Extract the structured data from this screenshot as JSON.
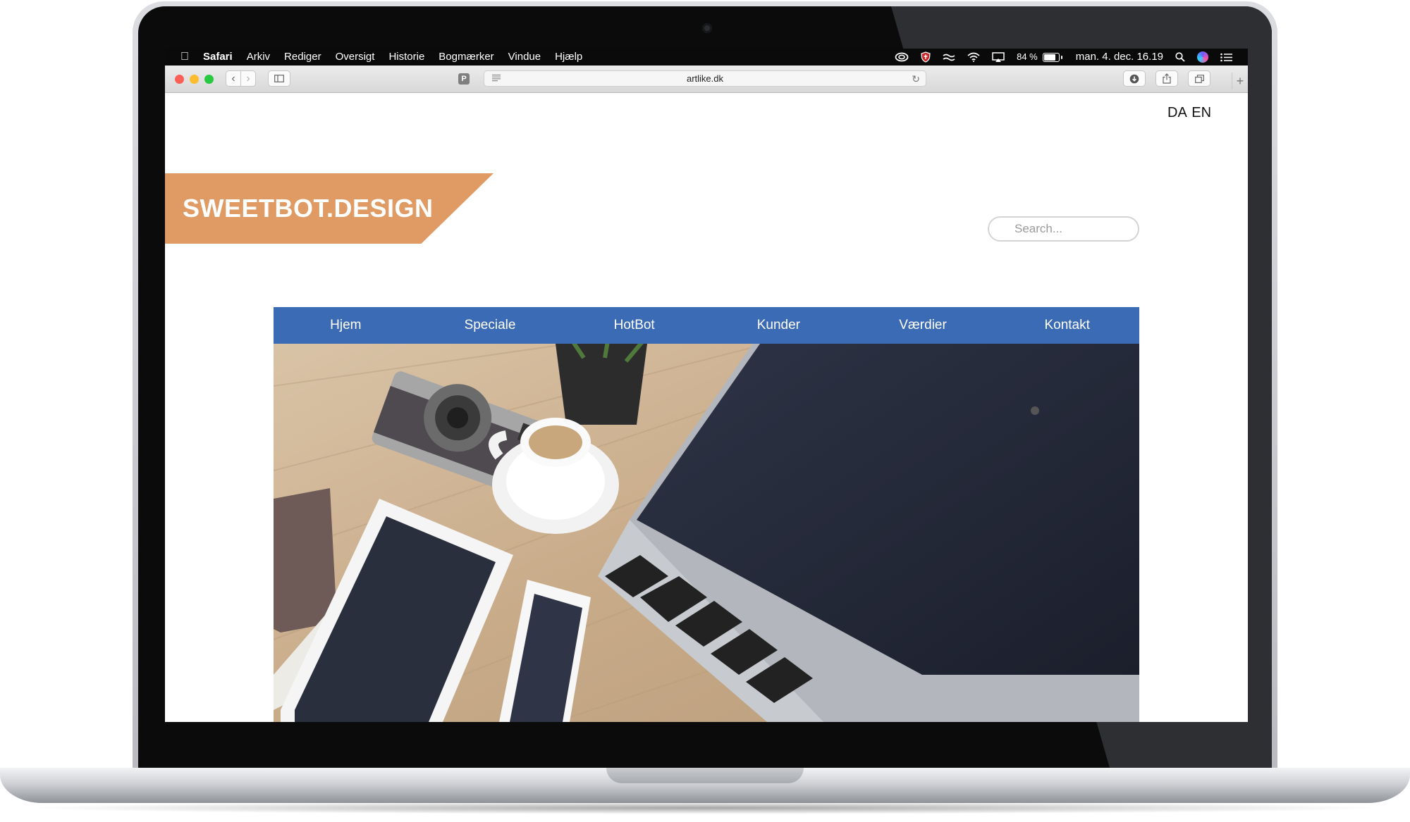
{
  "menubar": {
    "apple": "",
    "app": "Safari",
    "menus": [
      "Arkiv",
      "Rediger",
      "Oversigt",
      "Historie",
      "Bogmærker",
      "Vindue",
      "Hjælp"
    ],
    "battery": "84 %",
    "battery_level": 0.84,
    "datetime": "man. 4. dec. 16.19",
    "icons": [
      "creative-cloud-icon",
      "shield-icon",
      "bridge-icon",
      "wifi-icon",
      "airplay-icon",
      "battery-icon",
      "spotlight-icon",
      "siri-icon",
      "notification-center-icon"
    ]
  },
  "browser": {
    "url": "artlike.dk",
    "reader_badge": "P",
    "nav_back": "‹",
    "nav_forward": "›",
    "reload": "↻",
    "new_tab": "+"
  },
  "site": {
    "lang": "DA EN",
    "logo": "SWEETBOT.DESIGN",
    "search_placeholder": "Search...",
    "nav": [
      "Hjem",
      "Speciale",
      "HotBot",
      "Kunder",
      "Værdier",
      "Kontakt"
    ],
    "colors": {
      "logo_banner": "#df9b63",
      "nav_bar": "#3c6bb5"
    }
  }
}
